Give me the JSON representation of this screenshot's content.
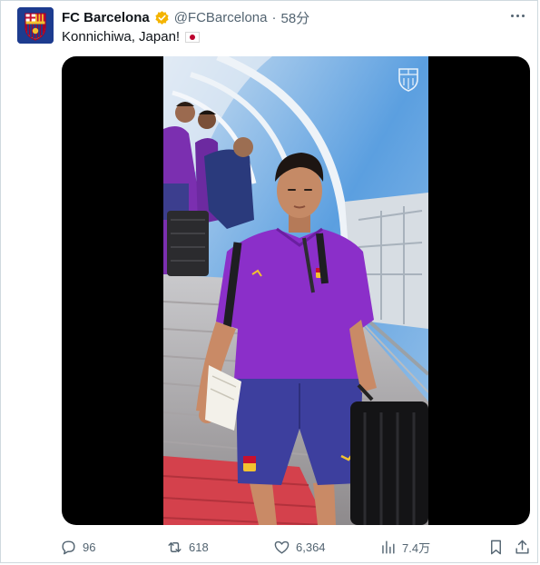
{
  "post": {
    "author_name": "FC Barcelona",
    "handle": "@FCBarcelona",
    "separator": "·",
    "time": "58分",
    "text": "Konnichiwa, Japan!",
    "flag_icon": "japan-flag-icon"
  },
  "media": {
    "type": "video",
    "watermark_icon": "fc-barcelona-crest-icon"
  },
  "actions": {
    "replies": "96",
    "reposts": "618",
    "likes": "6,364",
    "views": "7.4万"
  },
  "colors": {
    "verified_badge": "#f4b400",
    "text_secondary": "#536471",
    "text_primary": "#0f1419",
    "border": "#cfd9de",
    "jersey_purple": "#8b2fc9",
    "shorts_navy": "#3d3f9e"
  }
}
